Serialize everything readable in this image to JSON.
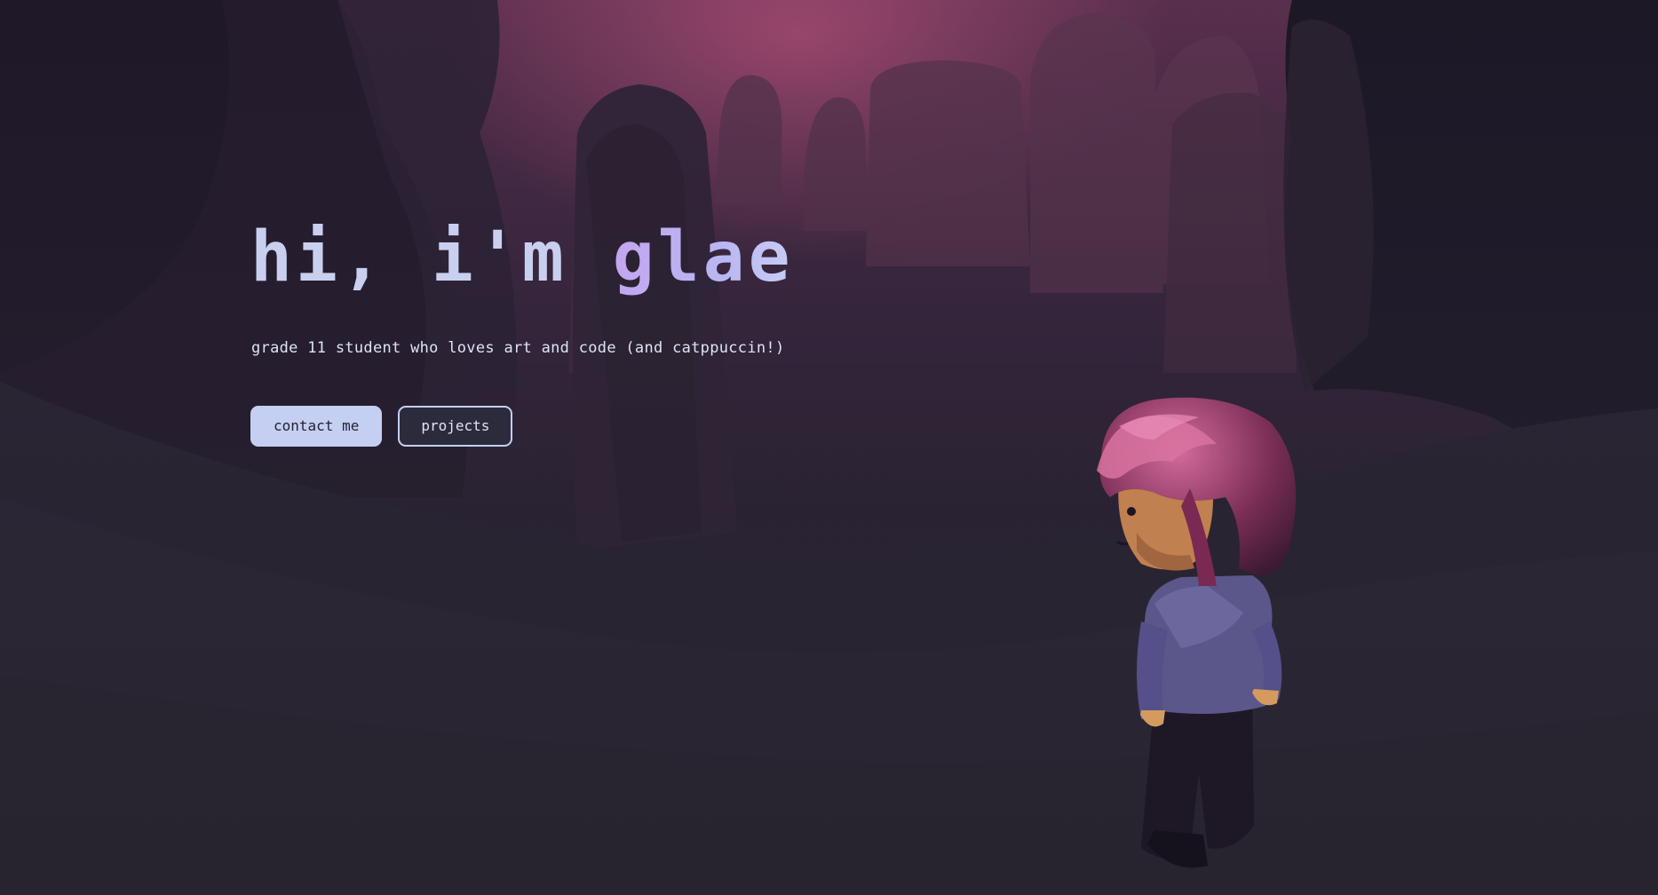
{
  "hero": {
    "title_prefix": "hi, i'm ",
    "title_name": "glae",
    "subtitle": "grade 11 student who loves art and code (and catppuccin!)",
    "actions": {
      "contact_label": "contact me",
      "projects_label": "projects"
    }
  },
  "colors": {
    "sky": "#8c4266",
    "background_dark": "#1e1b2b",
    "text_primary": "#c9d0ef",
    "accent_name": "#c3a6ef",
    "button_primary_bg": "#c5cff2",
    "button_secondary_bg": "#2b2b3c"
  }
}
